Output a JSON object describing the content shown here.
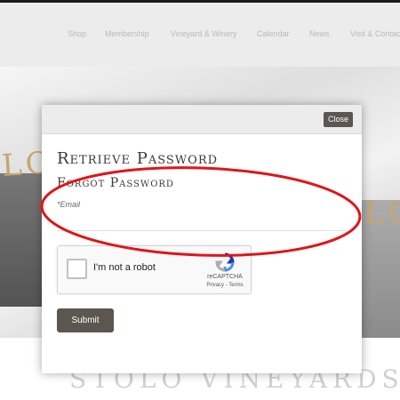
{
  "nav": {
    "items": [
      "Shop",
      "Membership",
      "Vineyard & Winery",
      "Calendar",
      "News",
      "Visit & Contact"
    ]
  },
  "hero": {
    "letters_left": "LO",
    "letters_right": "LO"
  },
  "footer": {
    "brand": "STOLO VINEYARDS"
  },
  "modal": {
    "close_label": "Close",
    "title": "Retrieve Password",
    "subtitle": "Forgot Password",
    "email_label": "*Email",
    "email_value": "",
    "captcha": {
      "label": "I'm not a robot",
      "brand": "reCAPTCHA",
      "links": "Privacy - Terms"
    },
    "submit_label": "Submit"
  },
  "colors": {
    "button": "#5c5650",
    "annotation": "#e0151b",
    "accent_gold": "#c7a76c"
  }
}
